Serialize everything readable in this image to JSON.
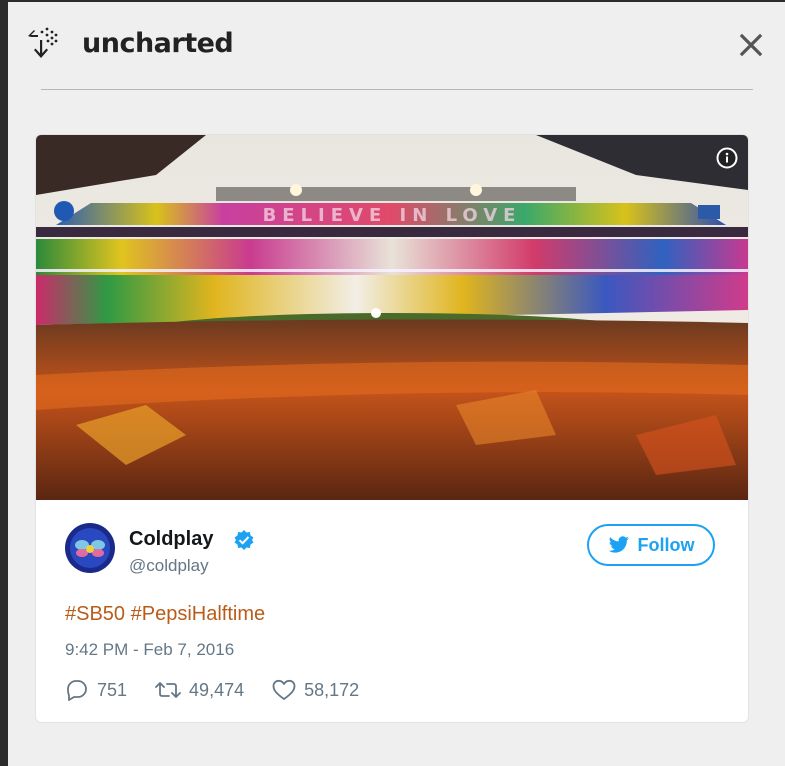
{
  "app": {
    "logo_text": "uncharted",
    "close_label": "×"
  },
  "tweet": {
    "author_name": "Coldplay",
    "author_handle": "@coldplay",
    "verified": true,
    "follow_label": "Follow",
    "hashtags": [
      "#SB50",
      "#PepsiHalftime"
    ],
    "timestamp": "9:42 PM - Feb 7, 2016",
    "replies": "751",
    "retweets": "49,474",
    "likes": "58,172",
    "photo_description": "stadium halftime show crowd",
    "stadium_banner": "BELIEVE IN LOVE"
  },
  "colors": {
    "twitter_blue": "#1da1f2",
    "hashtag": "#b85c1a",
    "muted": "#657786",
    "panel_bg": "#efefef"
  },
  "icons": {
    "logo": "uncharted-logo-icon",
    "close": "close-icon",
    "info": "info-icon",
    "verified": "verified-badge-icon",
    "twitter": "twitter-bird-icon",
    "reply": "reply-icon",
    "retweet": "retweet-icon",
    "like": "heart-icon"
  }
}
